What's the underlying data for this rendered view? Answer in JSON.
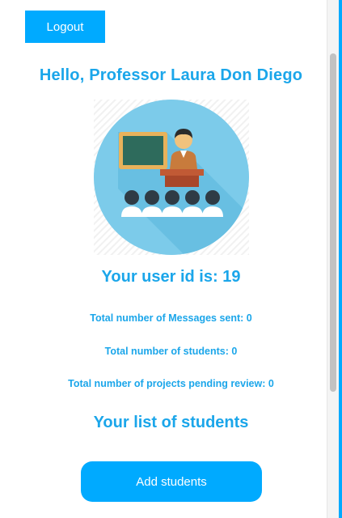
{
  "header": {
    "logout_label": "Logout"
  },
  "profile": {
    "greeting": "Hello, Professor Laura Don Diego",
    "avatar_icon": "teacher-classroom-icon",
    "user_id_text": "Your user id is: 19"
  },
  "stats": {
    "messages_sent": "Total number of Messages sent: 0",
    "students": "Total number of students: 0",
    "projects_pending": "Total number of projects pending review: 0"
  },
  "students_section": {
    "heading": "Your list of students",
    "add_label": "Add students"
  },
  "colors": {
    "accent": "#00aaff",
    "heading_text": "#1ba6ea",
    "avatar_circle": "#7ccbea"
  }
}
